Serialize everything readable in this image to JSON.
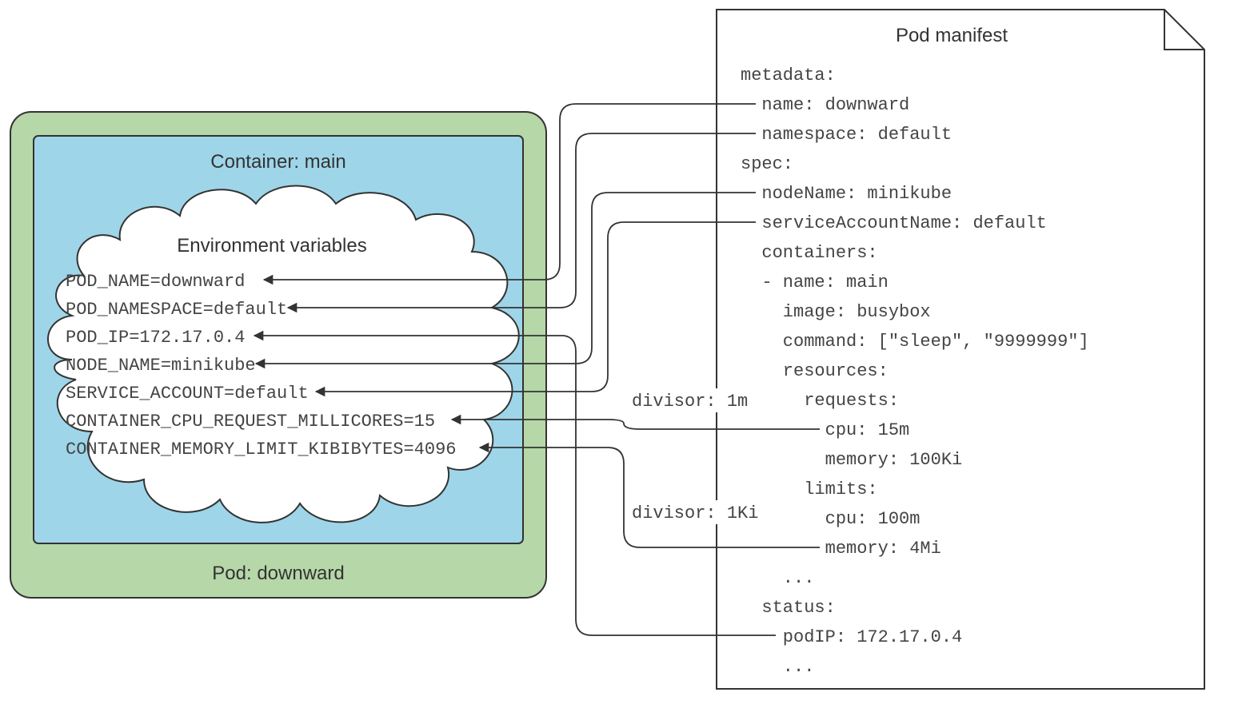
{
  "pod_label": "Pod: downward",
  "container_label": "Container: main",
  "env_title": "Environment variables",
  "env": {
    "e1": "POD_NAME=downward",
    "e2": "POD_NAMESPACE=default",
    "e3": "POD_IP=172.17.0.4",
    "e4": "NODE_NAME=minikube",
    "e5": "SERVICE_ACCOUNT=default",
    "e6": "CONTAINER_CPU_REQUEST_MILLICORES=15",
    "e7": "CONTAINER_MEMORY_LIMIT_KIBIBYTES=4096"
  },
  "divisor1": "divisor: 1m",
  "divisor2": "divisor: 1Ki",
  "manifest_title": "Pod manifest",
  "manifest": {
    "l1": "metadata:",
    "l2": "  name: downward",
    "l3": "  namespace: default",
    "l4": "spec:",
    "l5": "  nodeName: minikube",
    "l6": "  serviceAccountName: default",
    "l7": "  containers:",
    "l8": "  - name: main",
    "l9": "    image: busybox",
    "l10": "    command: [\"sleep\", \"9999999\"]",
    "l11": "    resources:",
    "l12": "      requests:",
    "l13": "        cpu: 15m",
    "l14": "        memory: 100Ki",
    "l15": "      limits:",
    "l16": "        cpu: 100m",
    "l17": "        memory: 4Mi",
    "l18": "    ...",
    "l19": "  status:",
    "l20": "    podIP: 172.17.0.4",
    "l21": "    ..."
  }
}
